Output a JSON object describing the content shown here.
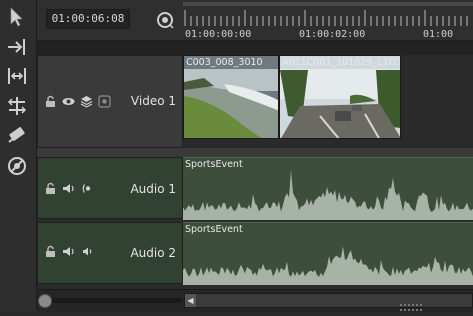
{
  "timecode": "01:00:06:08",
  "ruler": {
    "labels": [
      "01:00:00:00",
      "01:00:02:00",
      "01:00"
    ]
  },
  "tracks": {
    "video1": {
      "name": "Video 1",
      "clips": [
        {
          "name": "C003_008_3010"
        },
        {
          "name": "A011C001_101029_L1O3 (A011C0"
        }
      ]
    },
    "audio1": {
      "name": "Audio 1",
      "clip_name": "SportsEvent"
    },
    "audio2": {
      "name": "Audio 2",
      "clip_name": "SportsEvent"
    }
  },
  "tools": [
    "select-icon",
    "ripple-icon",
    "slip-icon",
    "slide-icon",
    "razor-icon",
    "ban-icon"
  ],
  "colors": {
    "audio_track": "#324232",
    "audio_clip": "#3d4e3d",
    "waveform": "#a8b3a8",
    "video_header": "#3a3a3a"
  }
}
